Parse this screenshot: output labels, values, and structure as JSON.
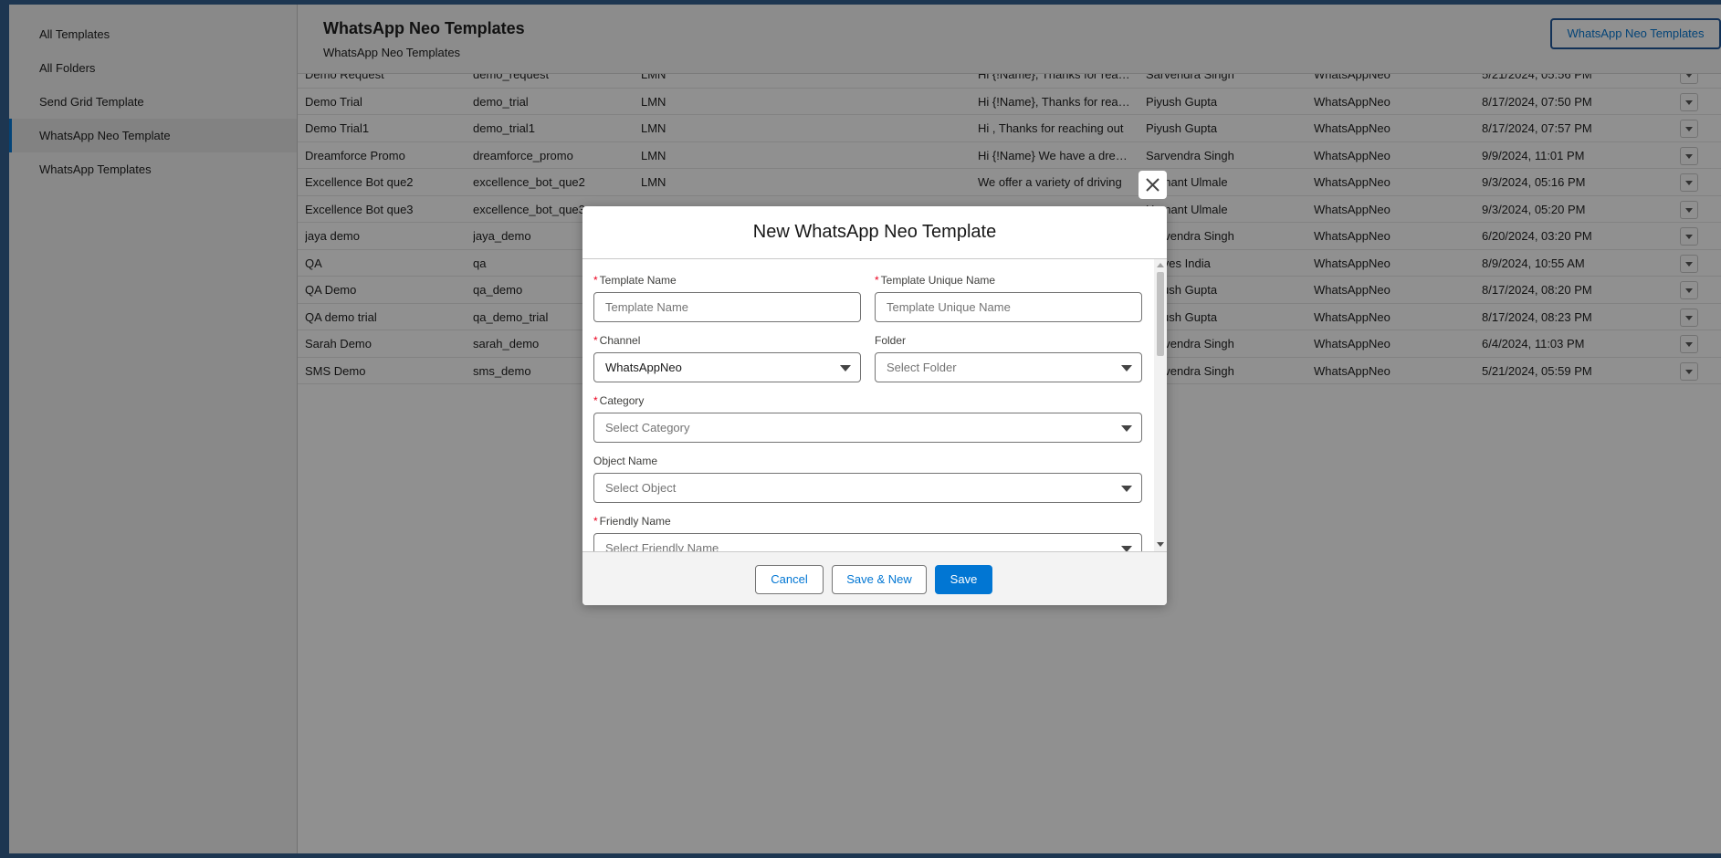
{
  "sidebar": {
    "items": [
      {
        "label": "All Templates"
      },
      {
        "label": "All Folders"
      },
      {
        "label": "Send Grid Template"
      },
      {
        "label": "WhatsApp Neo Template"
      },
      {
        "label": "WhatsApp Templates"
      }
    ]
  },
  "header": {
    "title": "WhatsApp Neo Templates",
    "subtitle": "WhatsApp Neo Templates",
    "button_label": "WhatsApp Neo Templates"
  },
  "table": {
    "rows": [
      [
        "Demo Request",
        "demo_request",
        "LMN",
        "Hi {!Name}, Thanks for reaching out",
        "Sarvendra Singh",
        "WhatsAppNeo",
        "5/21/2024, 05:56 PM"
      ],
      [
        "Demo Trial",
        "demo_trial",
        "LMN",
        "Hi {!Name}, Thanks for reaching out",
        "Piyush Gupta",
        "WhatsAppNeo",
        "8/17/2024, 07:50 PM"
      ],
      [
        "Demo Trial1",
        "demo_trial1",
        "LMN",
        "Hi , Thanks for reaching out",
        "Piyush Gupta",
        "WhatsAppNeo",
        "8/17/2024, 07:57 PM"
      ],
      [
        "Dreamforce Promo",
        "dreamforce_promo",
        "LMN",
        "Hi {!Name} We have a dreamforce",
        "Sarvendra Singh",
        "WhatsAppNeo",
        "9/9/2024, 11:01 PM"
      ],
      [
        "Excellence Bot que2",
        "excellence_bot_que2",
        "LMN",
        "We offer a variety of driving",
        "Hemant Ulmale",
        "WhatsAppNeo",
        "9/3/2024, 05:16 PM"
      ],
      [
        "Excellence Bot que3",
        "excellence_bot_que3",
        "",
        "",
        "Hemant Ulmale",
        "WhatsAppNeo",
        "9/3/2024, 05:20 PM"
      ],
      [
        "jaya demo",
        "jaya_demo",
        "",
        "",
        "Sarvendra Singh",
        "WhatsAppNeo",
        "6/20/2024, 03:20 PM"
      ],
      [
        "QA",
        "qa",
        "",
        "",
        "Solves India",
        "WhatsAppNeo",
        "8/9/2024, 10:55 AM"
      ],
      [
        "QA Demo",
        "qa_demo",
        "",
        "",
        "Piyush Gupta",
        "WhatsAppNeo",
        "8/17/2024, 08:20 PM"
      ],
      [
        "QA demo trial",
        "qa_demo_trial",
        "",
        "",
        "Piyush Gupta",
        "WhatsAppNeo",
        "8/17/2024, 08:23 PM"
      ],
      [
        "Sarah Demo",
        "sarah_demo",
        "",
        "",
        "Sarvendra Singh",
        "WhatsAppNeo",
        "6/4/2024, 11:03 PM"
      ],
      [
        "SMS Demo",
        "sms_demo",
        "",
        "",
        "Sarvendra Singh",
        "WhatsAppNeo",
        "5/21/2024, 05:59 PM"
      ]
    ]
  },
  "modal": {
    "title": "New WhatsApp Neo Template",
    "close_icon": "close-icon",
    "fields": {
      "template_name": {
        "label": "Template Name",
        "placeholder": "Template Name",
        "required": true
      },
      "template_unique_name": {
        "label": "Template Unique Name",
        "placeholder": "Template Unique Name",
        "required": true
      },
      "channel": {
        "label": "Channel",
        "value": "WhatsAppNeo",
        "required": true
      },
      "folder": {
        "label": "Folder",
        "placeholder": "Select Folder",
        "required": false
      },
      "category": {
        "label": "Category",
        "placeholder": "Select Category",
        "required": true
      },
      "object_name": {
        "label": "Object Name",
        "placeholder": "Select Object",
        "required": false
      },
      "friendly_name": {
        "label": "Friendly Name",
        "placeholder": "Select Friendly Name",
        "required": true
      }
    },
    "required_mark": "*",
    "buttons": {
      "cancel": "Cancel",
      "save_new": "Save & New",
      "save": "Save"
    }
  },
  "colors": {
    "brand": "#0176d3",
    "required": "#ea001e",
    "overlay": "#080808"
  }
}
